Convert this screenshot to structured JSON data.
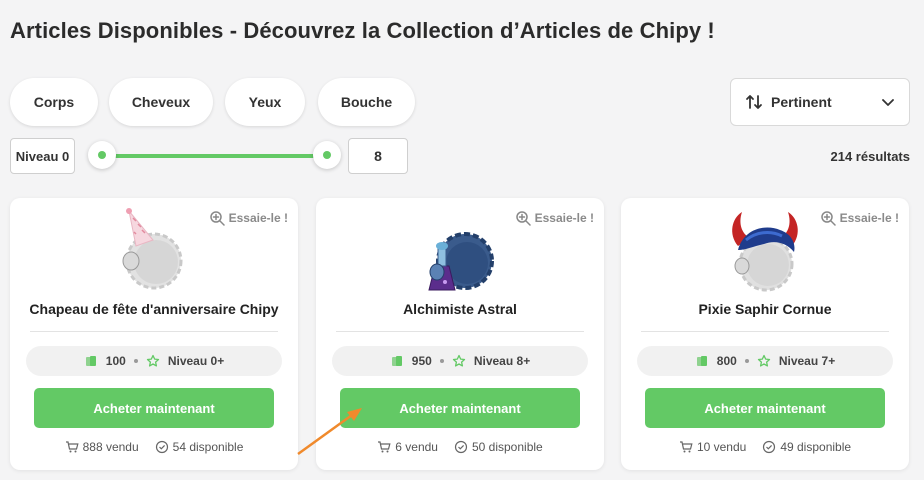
{
  "page": {
    "title": "Articles Disponibles - Découvrez la Collection d’Articles de Chipy !"
  },
  "filters": [
    {
      "label": "Corps"
    },
    {
      "label": "Cheveux"
    },
    {
      "label": "Yeux"
    },
    {
      "label": "Bouche"
    }
  ],
  "sort": {
    "label": "Pertinent",
    "icon": "sort-icon"
  },
  "level": {
    "min_label": "Niveau 0",
    "max_value": "8",
    "min_fraction": 0,
    "max_fraction": 1
  },
  "results": {
    "text": "214 résultats"
  },
  "colors": {
    "accent": "#63c965",
    "coin": "#63c965"
  },
  "cards": [
    {
      "try_label": "Essaie-le !",
      "name": "Chapeau de fête d'anniversaire Chipy",
      "price": "100",
      "level": "Niveau 0+",
      "buy_label": "Acheter maintenant",
      "sold": "888 vendu",
      "available": "54 disponible"
    },
    {
      "try_label": "Essaie-le !",
      "name": "Alchimiste Astral",
      "price": "950",
      "level": "Niveau 8+",
      "buy_label": "Acheter maintenant",
      "sold": "6 vendu",
      "available": "50 disponible"
    },
    {
      "try_label": "Essaie-le !",
      "name": "Pixie Saphir Cornue",
      "price": "800",
      "level": "Niveau 7+",
      "buy_label": "Acheter maintenant",
      "sold": "10 vendu",
      "available": "49 disponible"
    }
  ]
}
